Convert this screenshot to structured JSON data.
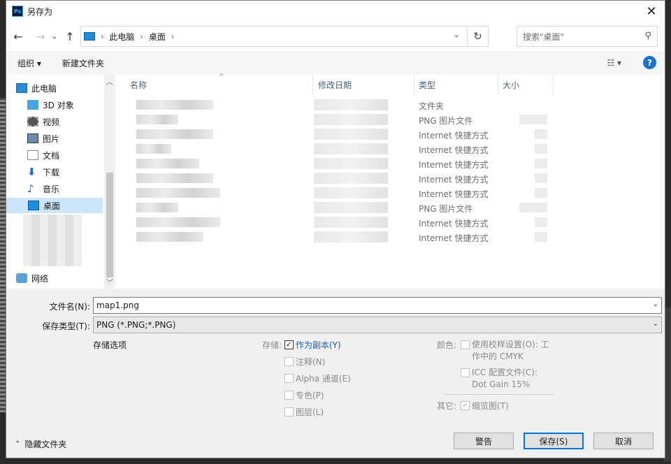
{
  "window": {
    "title": "另存为",
    "app_icon": "Ps"
  },
  "nav": {
    "breadcrumb": [
      "此电脑",
      "桌面"
    ],
    "search_placeholder": "搜索\"桌面\""
  },
  "toolbar": {
    "organize": "组织 ▾",
    "new_folder": "新建文件夹",
    "help": "?"
  },
  "sidebar": {
    "items": [
      {
        "label": "此电脑",
        "icon": "computer-icon"
      },
      {
        "label": "3D 对象",
        "icon": "cube-icon"
      },
      {
        "label": "视频",
        "icon": "film-icon"
      },
      {
        "label": "图片",
        "icon": "picture-icon"
      },
      {
        "label": "文档",
        "icon": "document-icon"
      },
      {
        "label": "下载",
        "icon": "download-icon"
      },
      {
        "label": "音乐",
        "icon": "music-icon"
      },
      {
        "label": "桌面",
        "icon": "desktop-icon",
        "selected": true
      },
      {
        "label": "网络",
        "icon": "network-icon"
      }
    ]
  },
  "columns": {
    "name": "名称",
    "date": "修改日期",
    "type": "类型",
    "size": "大小"
  },
  "files": [
    {
      "type": "文件夹",
      "color": "#f5d67a"
    },
    {
      "type": "PNG 图片文件",
      "color": "#bcd6a8"
    },
    {
      "type": "Internet 快捷方式",
      "color": "#c79a9a"
    },
    {
      "type": "Internet 快捷方式",
      "color": "#7e7a6c"
    },
    {
      "type": "Internet 快捷方式",
      "color": "#d6d0c4"
    },
    {
      "type": "Internet 快捷方式",
      "color": "#a47f84"
    },
    {
      "type": "Internet 快捷方式",
      "color": "#5b6066"
    },
    {
      "type": "PNG 图片文件",
      "color": "#c9d8b8"
    },
    {
      "type": "Internet 快捷方式",
      "color": "#9a9a9a"
    },
    {
      "type": "Internet 快捷方式",
      "color": "#b8b8b8"
    }
  ],
  "form": {
    "filename_label": "文件名(N):",
    "filename_value": "map1.png",
    "filetype_label": "保存类型(T):",
    "filetype_value": "PNG (*.PNG;*.PNG)",
    "storage_options": "存储选项",
    "save_label": "存储:",
    "save_opts": [
      {
        "label": "作为副本(Y)",
        "checked": true,
        "enabled": true
      },
      {
        "label": "注释(N)",
        "checked": false,
        "enabled": false
      },
      {
        "label": "Alpha 通道(E)",
        "checked": false,
        "enabled": false
      },
      {
        "label": "专色(P)",
        "checked": false,
        "enabled": false
      },
      {
        "label": "图层(L)",
        "checked": false,
        "enabled": false
      }
    ],
    "color_label": "颜色:",
    "proof_label_1": "使用校样设置(O): 工",
    "proof_label_2": "作中的 CMYK",
    "icc_label_1": "ICC 配置文件(C):",
    "icc_label_2": "Dot Gain 15%",
    "other_label": "其它:",
    "thumbnail_label": "缩览图(T)"
  },
  "footer": {
    "hide_folders": "隐藏文件夹",
    "warning_button": "警告",
    "save_button": "保存(S)",
    "cancel_button": "取消"
  }
}
